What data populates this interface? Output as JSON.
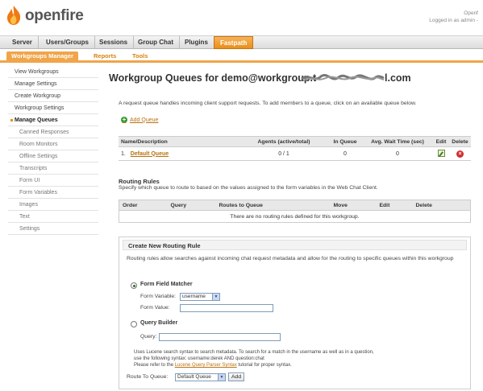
{
  "header": {
    "logo_text": "openfire",
    "right_line1": "Openf",
    "right_line2": "Logged in as admin -"
  },
  "main_tabs": [
    {
      "label": "Server"
    },
    {
      "label": "Users/Groups"
    },
    {
      "label": "Sessions"
    },
    {
      "label": "Group Chat"
    },
    {
      "label": "Plugins"
    },
    {
      "label": "Fastpath",
      "active": true
    }
  ],
  "sub_tabs": [
    {
      "label": "Workgroups Manager",
      "active": true
    },
    {
      "label": "Reports"
    },
    {
      "label": "Tools"
    }
  ],
  "sidebar": {
    "items": [
      {
        "label": "View Workgroups"
      },
      {
        "label": "Manage Settings"
      },
      {
        "label": "Create Workgroup"
      },
      {
        "label": "Workgroup Settings"
      },
      {
        "label": "Manage Queues",
        "active": true
      },
      {
        "label": "Canned Responses"
      },
      {
        "label": "Room Monitors"
      },
      {
        "label": "Offline Settings"
      },
      {
        "label": "Transcripts"
      },
      {
        "label": "Form UI"
      },
      {
        "label": "Form Variables"
      },
      {
        "label": "Images"
      },
      {
        "label": "Text"
      },
      {
        "label": "Settings"
      }
    ]
  },
  "page": {
    "title_prefix": "Workgroup Queues for demo@workgroup.t",
    "title_suffix": "l.com",
    "intro": "A request queue handles incoming client support requests. To add members to a queue, click on an available queue below.",
    "add_queue": "Add Queue"
  },
  "queue_table": {
    "headers": {
      "name": "Name/Description",
      "agents": "Agents (active/total)",
      "in_queue": "In Queue",
      "avg_wait": "Avg. Wait Time (sec)",
      "edit": "Edit",
      "delete": "Delete"
    },
    "rows": [
      {
        "num": "1.",
        "name": "Default Queue",
        "agents": "0 / 1",
        "in_queue": "0",
        "avg_wait": "0"
      }
    ]
  },
  "routing": {
    "title": "Routing Rules",
    "desc": "Specify which queue to route to based on the values assigned to the form variables in the Web Chat Client.",
    "headers": {
      "order": "Order",
      "query": "Query",
      "routes_to": "Routes to Queue",
      "move": "Move",
      "edit": "Edit",
      "delete": "Delete"
    },
    "empty": "There are no routing rules defined for this workgroup."
  },
  "new_rule": {
    "title": "Create New Routing Rule",
    "desc": "Routing rules allow searches against incoming chat request metadata and allow for the routing to specific queues within this workgroup",
    "form_field_matcher": "Form Field Matcher",
    "form_variable_label": "Form Variable:",
    "form_variable_value": "username",
    "form_value_label": "Form Value:",
    "query_builder": "Query Builder",
    "query_label": "Query:",
    "help_line1": "Uses Lucene search syntax to search metadata. To search for a match in the username as well as in a question,",
    "help_line2": "use the following syntax: username:derek AND question:chat",
    "help_line3_pre": "Please refer to the ",
    "help_link": "Lucene Query Parser Syntax",
    "help_line3_post": " tutorial for proper syntax.",
    "route_to_label": "Route To Queue:",
    "route_to_value": "Default Queue",
    "add_button": "Add"
  }
}
